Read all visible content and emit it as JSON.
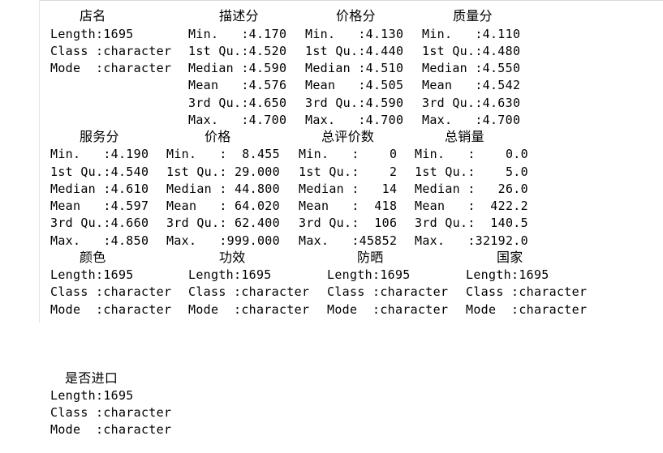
{
  "blocks": [
    {
      "headers": [
        "店名",
        "描述分",
        "价格分",
        "质量分"
      ],
      "rows": [
        [
          "Length:1695",
          "Min.   :4.170",
          "Min.   :4.130",
          "Min.   :4.110"
        ],
        [
          "Class :character",
          "1st Qu.:4.520",
          "1st Qu.:4.440",
          "1st Qu.:4.480"
        ],
        [
          "Mode  :character",
          "Median :4.590",
          "Median :4.510",
          "Median :4.550"
        ],
        [
          "",
          "Mean   :4.576",
          "Mean   :4.505",
          "Mean   :4.542"
        ],
        [
          "",
          "3rd Qu.:4.650",
          "3rd Qu.:4.590",
          "3rd Qu.:4.630"
        ],
        [
          "",
          "Max.   :4.700",
          "Max.   :4.700",
          "Max.   :4.700"
        ]
      ]
    },
    {
      "headers": [
        "服务分",
        "价格",
        "总评价数",
        "总销量"
      ],
      "rows": [
        [
          "Min.   :4.190",
          "Min.   :  8.455",
          "Min.   :    0",
          "Min.   :    0.0"
        ],
        [
          "1st Qu.:4.540",
          "1st Qu.: 29.000",
          "1st Qu.:    2",
          "1st Qu.:    5.0"
        ],
        [
          "Median :4.610",
          "Median : 44.800",
          "Median :   14",
          "Median :   26.0"
        ],
        [
          "Mean   :4.597",
          "Mean   : 64.020",
          "Mean   :  418",
          "Mean   :  422.2"
        ],
        [
          "3rd Qu.:4.660",
          "3rd Qu.: 62.400",
          "3rd Qu.:  106",
          "3rd Qu.:  140.5"
        ],
        [
          "Max.   :4.850",
          "Max.   :999.000",
          "Max.   :45852",
          "Max.   :32192.0"
        ]
      ]
    },
    {
      "headers": [
        "颜色",
        "功效",
        "防晒",
        "国家"
      ],
      "rows": [
        [
          "Length:1695",
          "Length:1695",
          "Length:1695",
          "Length:1695"
        ],
        [
          "Class :character",
          "Class :character",
          "Class :character",
          "Class :character"
        ],
        [
          "Mode  :character",
          "Mode  :character",
          "Mode  :character",
          "Mode  :character"
        ]
      ]
    },
    {
      "headers": [
        "是否进口"
      ],
      "rows": [
        [
          "Length:1695"
        ],
        [
          "Class :character"
        ],
        [
          "Mode  :character"
        ]
      ]
    }
  ]
}
